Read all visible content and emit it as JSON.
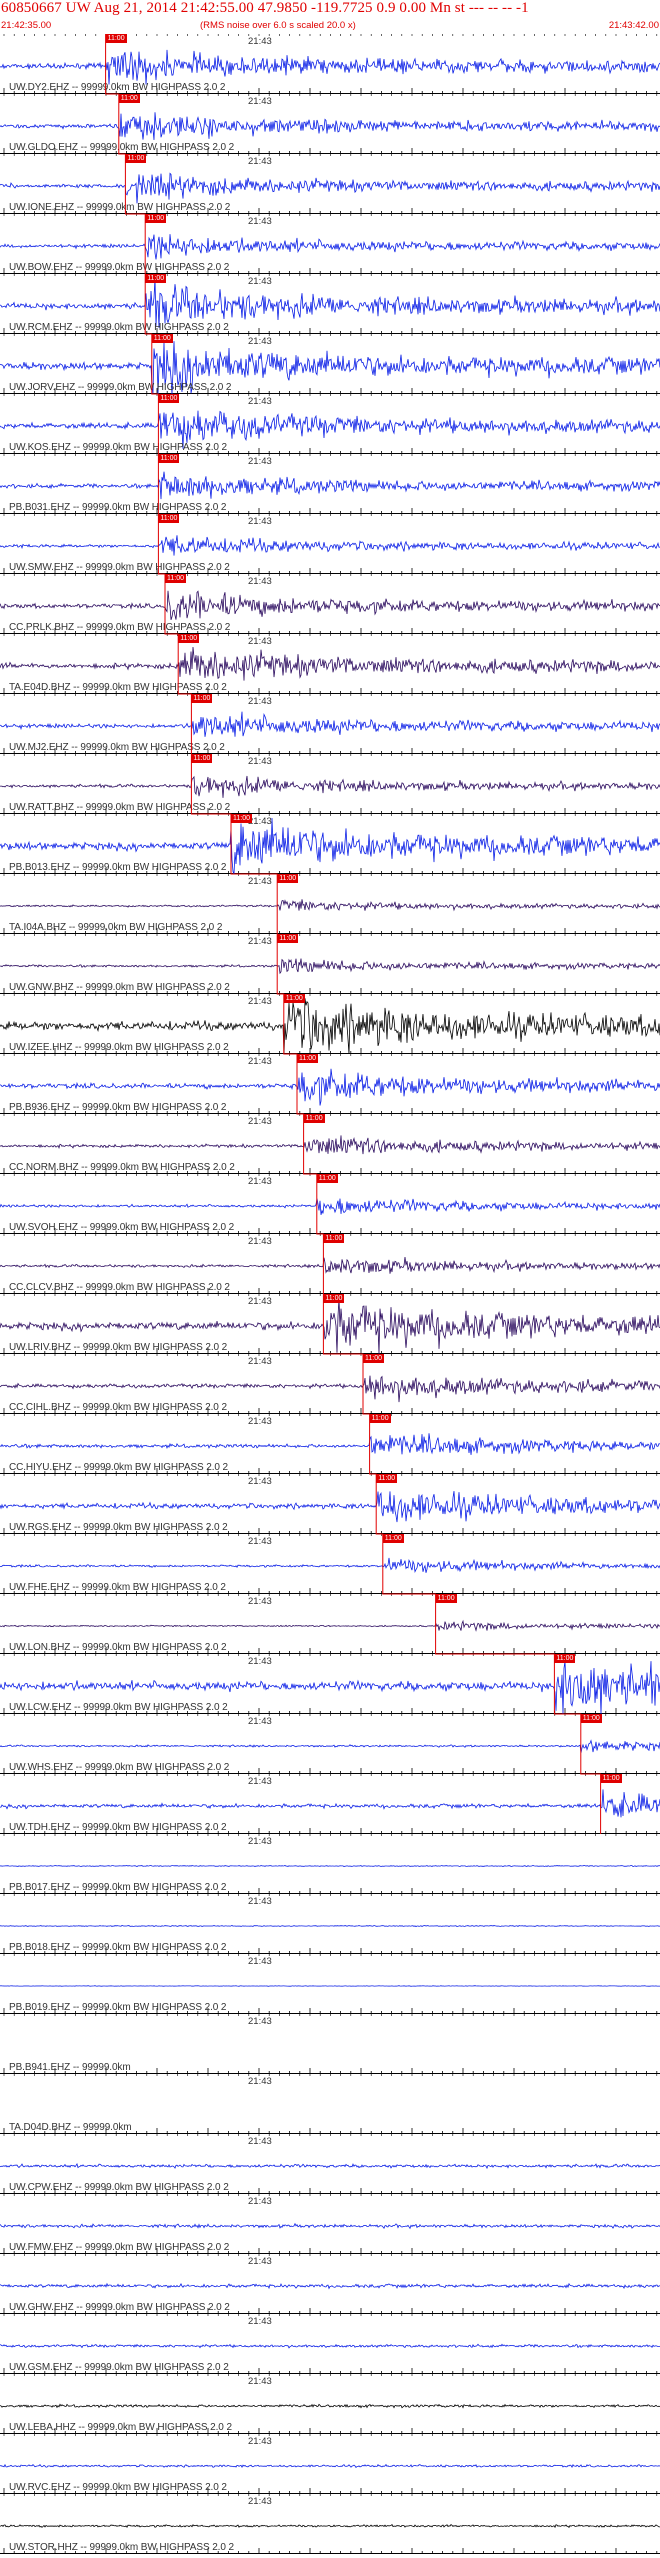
{
  "header": {
    "title": "60850667 UW Aug 21, 2014 21:42:55.00   47.9850 -119.7725  0.9 0.00 Mn st --- -- --   -1",
    "start_time": "21:42:35.00",
    "rms_note": "(RMS noise over 6.0 s scaled 20.0 x)",
    "end_time": "21:43:42.00"
  },
  "colors": {
    "blue": "#0a1ee6",
    "purple": "#2a0a5e",
    "black": "#000000",
    "red": "#e00000"
  },
  "tick_label": "21:43",
  "panels": [
    {
      "label": "UW.DY2.EHZ -- 99999.0km BW  HIGHPASS  2.0  2",
      "color": "blue",
      "amp": 0.6,
      "pick": 0.16,
      "pick_text": "11:00"
    },
    {
      "label": "UW.GLDO.EHZ -- 99999.0km BW  HIGHPASS  2.0  2",
      "color": "blue",
      "amp": 0.5,
      "pick": 0.18,
      "pick_text": "11:00"
    },
    {
      "label": "UW.IONE.EHZ -- 99999.0km BW  HIGHPASS  2.0  2",
      "color": "blue",
      "amp": 0.45,
      "pick": 0.19,
      "pick_text": "11:00"
    },
    {
      "label": "UW.BOW.EHZ -- 99999.0km BW  HIGHPASS  2.0  2",
      "color": "blue",
      "amp": 0.4,
      "pick": 0.22,
      "pick_text": "11:00"
    },
    {
      "label": "UW.RCM.EHZ -- 99999.0km BW  HIGHPASS  2.0  2",
      "color": "blue",
      "amp": 0.7,
      "pick": 0.22,
      "pick_text": "11:00"
    },
    {
      "label": "UW.JORV.EHZ -- 99999.0km BW  HIGHPASS  2.0  2",
      "color": "blue",
      "amp": 0.85,
      "pick": 0.23,
      "pick_text": "11:00"
    },
    {
      "label": "UW.KOS.EHZ -- 99999.0km BW  HIGHPASS  2.0  2",
      "color": "blue",
      "amp": 0.65,
      "pick": 0.24,
      "pick_text": "11:00"
    },
    {
      "label": "PB.B031.EHZ -- 99999.0km BW  HIGHPASS  2.0  2",
      "color": "blue",
      "amp": 0.45,
      "pick": 0.24,
      "pick_text": "11:00"
    },
    {
      "label": "UW.SMW.EHZ -- 99999.0km BW  HIGHPASS  2.0  2",
      "color": "blue",
      "amp": 0.35,
      "pick": 0.24,
      "pick_text": "11:00"
    },
    {
      "label": "CC.PRLK.BHZ -- 99999.0km BW  HIGHPASS  2.0  2",
      "color": "purple",
      "amp": 0.5,
      "pick": 0.25,
      "pick_text": "11:00"
    },
    {
      "label": "TA.E04D.BHZ -- 99999.0km BW  HIGHPASS  2.0  2",
      "color": "purple",
      "amp": 0.6,
      "pick": 0.27,
      "pick_text": "11:00"
    },
    {
      "label": "UW.MJ2.EHZ -- 99999.0km BW  HIGHPASS  2.0  2",
      "color": "blue",
      "amp": 0.45,
      "pick": 0.29,
      "pick_text": "11:00"
    },
    {
      "label": "UW.RATT.BHZ -- 99999.0km BW  HIGHPASS  2.0  2",
      "color": "purple",
      "amp": 0.35,
      "pick": 0.29,
      "pick_text": "11:00"
    },
    {
      "label": "PB.B013.EHZ -- 99999.0km BW  HIGHPASS  2.0  2",
      "color": "blue",
      "amp": 0.9,
      "pick": 0.35,
      "pick_text": "11:00"
    },
    {
      "label": "TA.I04A.BHZ -- 99999.0km BW  HIGHPASS  2.0  2",
      "color": "purple",
      "amp": 0.2,
      "pick": 0.42,
      "pick_text": "11:00"
    },
    {
      "label": "UW.GNW.BHZ -- 99999.0km BW  HIGHPASS  2.0  2",
      "color": "purple",
      "amp": 0.25,
      "pick": 0.42,
      "pick_text": "11:00"
    },
    {
      "label": "UW.IZEE.HHZ -- 99999.0km BW  HIGHPASS  2.0  2",
      "color": "black",
      "amp": 1.0,
      "pick": 0.43,
      "pick_text": "11:00"
    },
    {
      "label": "PB.B936.EHZ -- 99999.0km BW  HIGHPASS  2.0  2",
      "color": "blue",
      "amp": 0.55,
      "pick": 0.45,
      "pick_text": "11:00"
    },
    {
      "label": "CC.NORM.BHZ -- 99999.0km BW  HIGHPASS  2.0  2",
      "color": "purple",
      "amp": 0.35,
      "pick": 0.46,
      "pick_text": "11:00"
    },
    {
      "label": "UW.SVOH.EHZ -- 99999.0km BW  HIGHPASS  2.0  2",
      "color": "blue",
      "amp": 0.3,
      "pick": 0.48,
      "pick_text": "11:00"
    },
    {
      "label": "CC.CLCV.BHZ -- 99999.0km BW  HIGHPASS  2.0  2",
      "color": "purple",
      "amp": 0.3,
      "pick": 0.49,
      "pick_text": "11:00"
    },
    {
      "label": "UW.LRIV.BHZ -- 99999.0km BW  HIGHPASS  2.0  2",
      "color": "purple",
      "amp": 0.9,
      "pick": 0.49,
      "pick_text": "11:00"
    },
    {
      "label": "CC.CIHL.BHZ -- 99999.0km BW  HIGHPASS  2.0  2",
      "color": "purple",
      "amp": 0.45,
      "pick": 0.55,
      "pick_text": "11:00"
    },
    {
      "label": "CC.HIYU.EHZ -- 99999.0km BW  HIGHPASS  2.0  2",
      "color": "blue",
      "amp": 0.4,
      "pick": 0.56,
      "pick_text": "11:00"
    },
    {
      "label": "UW.RGS.EHZ -- 99999.0km BW  HIGHPASS  2.0  2",
      "color": "blue",
      "amp": 0.6,
      "pick": 0.57,
      "pick_text": "11:00"
    },
    {
      "label": "UW.FHE.EHZ -- 99999.0km BW  HIGHPASS  2.0  2",
      "color": "blue",
      "amp": 0.25,
      "pick": 0.58,
      "pick_text": "11:00"
    },
    {
      "label": "UW.LON.BHZ -- 99999.0km BW  HIGHPASS  2.0  2",
      "color": "purple",
      "amp": 0.15,
      "pick": 0.66,
      "pick_text": "11:00"
    },
    {
      "label": "UW.LCW.EHZ -- 99999.0km BW  HIGHPASS  2.0  2",
      "color": "blue",
      "amp": 1.0,
      "pick": 0.84,
      "pick_text": "11:00"
    },
    {
      "label": "UW.WHS.EHZ -- 99999.0km BW  HIGHPASS  2.0  2",
      "color": "blue",
      "amp": 0.2,
      "pick": 0.88,
      "pick_text": "11:00"
    },
    {
      "label": "UW.TDH.EHZ -- 99999.0km BW  HIGHPASS  2.0  2",
      "color": "blue",
      "amp": 0.45,
      "pick": 0.91,
      "pick_text": "11:00"
    },
    {
      "label": "PB.B017.EHZ -- 99999.0km BW  HIGHPASS  2.0  2",
      "color": "blue",
      "amp": 0.1,
      "pick": null,
      "pick_text": ""
    },
    {
      "label": "PB.B018.EHZ -- 99999.0km BW  HIGHPASS  2.0  2",
      "color": "blue",
      "amp": 0.1,
      "pick": null,
      "pick_text": ""
    },
    {
      "label": "PB.B019.EHZ -- 99999.0km BW  HIGHPASS  2.0  2",
      "color": "blue",
      "amp": 0.05,
      "pick": null,
      "pick_text": ""
    },
    {
      "label": "PB.B941.EHZ -- 99999.0km",
      "color": "blue",
      "amp": 0.0,
      "pick": null,
      "pick_text": ""
    },
    {
      "label": "TA.D04D.BHZ -- 99999.0km",
      "color": "purple",
      "amp": 0.0,
      "pick": null,
      "pick_text": ""
    },
    {
      "label": "UW.CPW.EHZ -- 99999.0km BW  HIGHPASS  2.0  2",
      "color": "blue",
      "amp": 0.35,
      "pick": null,
      "pick_text": ""
    },
    {
      "label": "UW.FMW.EHZ -- 99999.0km BW  HIGHPASS  2.0  2",
      "color": "blue",
      "amp": 0.35,
      "pick": null,
      "pick_text": ""
    },
    {
      "label": "UW.GHW.EHZ -- 99999.0km BW  HIGHPASS  2.0  2",
      "color": "blue",
      "amp": 0.4,
      "pick": null,
      "pick_text": ""
    },
    {
      "label": "UW.GSM.EHZ -- 99999.0km BW  HIGHPASS  2.0  2",
      "color": "blue",
      "amp": 0.3,
      "pick": null,
      "pick_text": ""
    },
    {
      "label": "UW.LEBA.HHZ -- 99999.0km BW  HIGHPASS  2.0  2",
      "color": "black",
      "amp": 0.3,
      "pick": null,
      "pick_text": ""
    },
    {
      "label": "UW.RVC.EHZ -- 99999.0km BW  HIGHPASS  2.0  2",
      "color": "blue",
      "amp": 0.25,
      "pick": null,
      "pick_text": ""
    },
    {
      "label": "UW.STOR.HHZ -- 99999.0km BW  HIGHPASS  2.0  2",
      "color": "black",
      "amp": 0.25,
      "pick": null,
      "pick_text": ""
    }
  ]
}
